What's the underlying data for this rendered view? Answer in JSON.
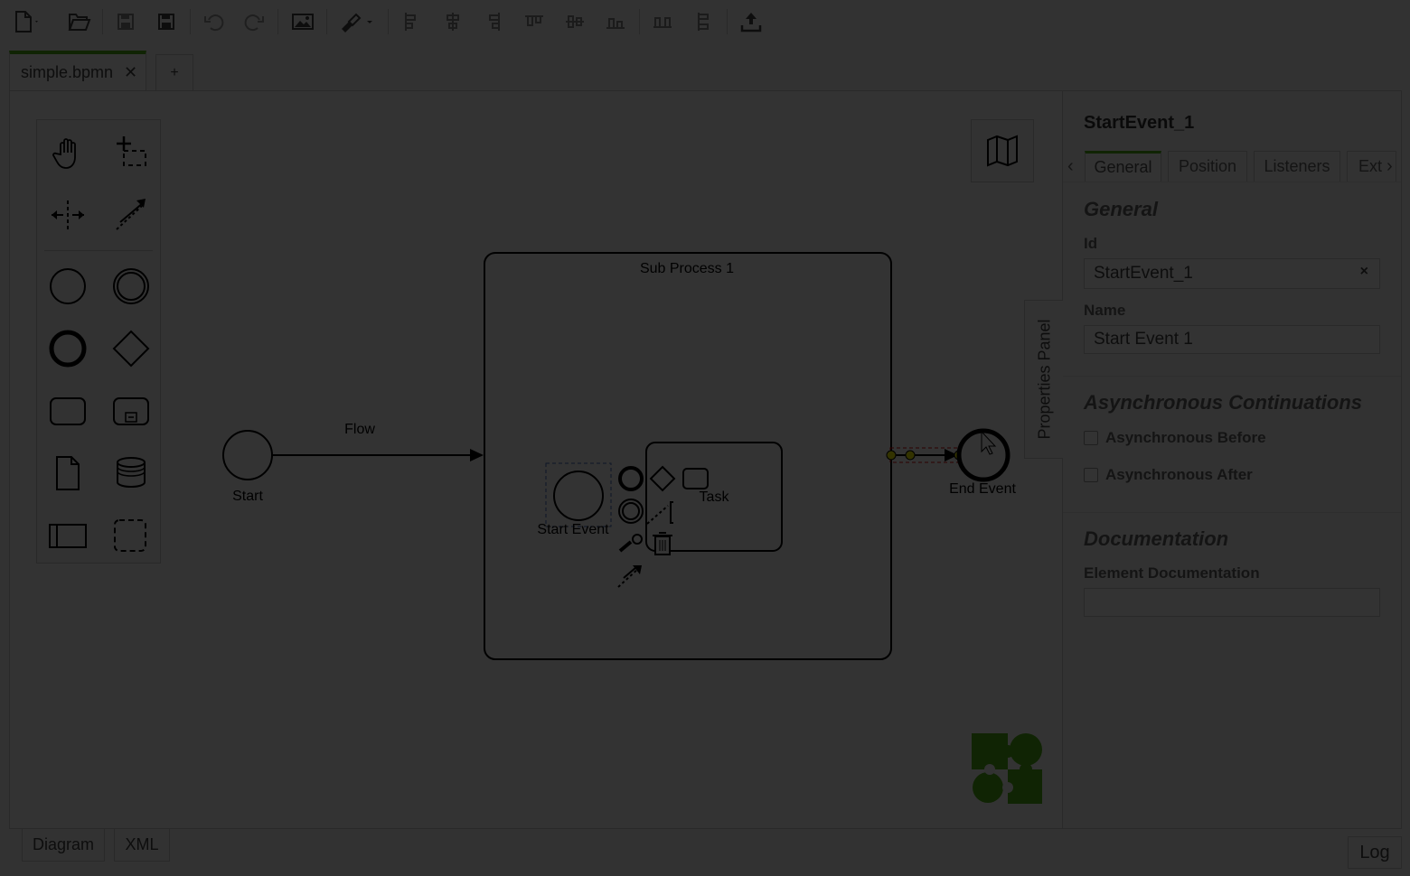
{
  "colors": {
    "accent": "#52b415",
    "overlay": "rgba(0,0,0,0.8)",
    "logo": "#52b415"
  },
  "toolbar": {
    "buttons": [
      "new-file-icon",
      "open-folder-icon",
      "save-icon",
      "save-as-icon",
      "undo-icon",
      "redo-icon",
      "export-image-icon",
      "color-brush-icon",
      "align-left-icon",
      "align-center-icon",
      "align-right-icon",
      "align-top-icon",
      "align-middle-icon",
      "align-bottom-icon",
      "distribute-horizontal-icon",
      "distribute-vertical-icon",
      "deploy-icon"
    ]
  },
  "tabs": {
    "file_name": "simple.bpmn",
    "close_symbol": "✕",
    "add_symbol": "+"
  },
  "palette": {
    "tools": [
      "hand-tool-icon",
      "lasso-tool-icon",
      "space-tool-icon",
      "global-connect-icon"
    ],
    "shapes": [
      "start-event-icon",
      "intermediate-event-icon",
      "end-event-icon",
      "gateway-icon",
      "task-icon",
      "subprocess-icon",
      "data-object-icon",
      "data-store-icon",
      "pool-icon",
      "group-icon"
    ]
  },
  "diagram": {
    "start_label": "Start",
    "flow_label": "Flow",
    "subprocess_label": "Sub Process 1",
    "inner_start_label": "Start Event",
    "task_label": "Task",
    "end_label": "End Event"
  },
  "properties_toggle": "Properties Panel",
  "properties": {
    "title": "StartEvent_1",
    "tabs": [
      "General",
      "Position",
      "Listeners",
      "Ext"
    ],
    "prev_arrow": "‹",
    "next_arrow": "›",
    "general": {
      "title": "General",
      "id_label": "Id",
      "id_value": "StartEvent_1",
      "clear_symbol": "×",
      "name_label": "Name",
      "name_value": "Start Event 1"
    },
    "async": {
      "title": "Asynchronous Continuations",
      "before_label": "Asynchronous Before",
      "before_checked": false,
      "after_label": "Asynchronous After",
      "after_checked": false
    },
    "documentation": {
      "title": "Documentation",
      "label": "Element Documentation",
      "value": ""
    }
  },
  "bottom": {
    "tab_diagram": "Diagram",
    "tab_xml": "XML",
    "log_button": "Log"
  }
}
